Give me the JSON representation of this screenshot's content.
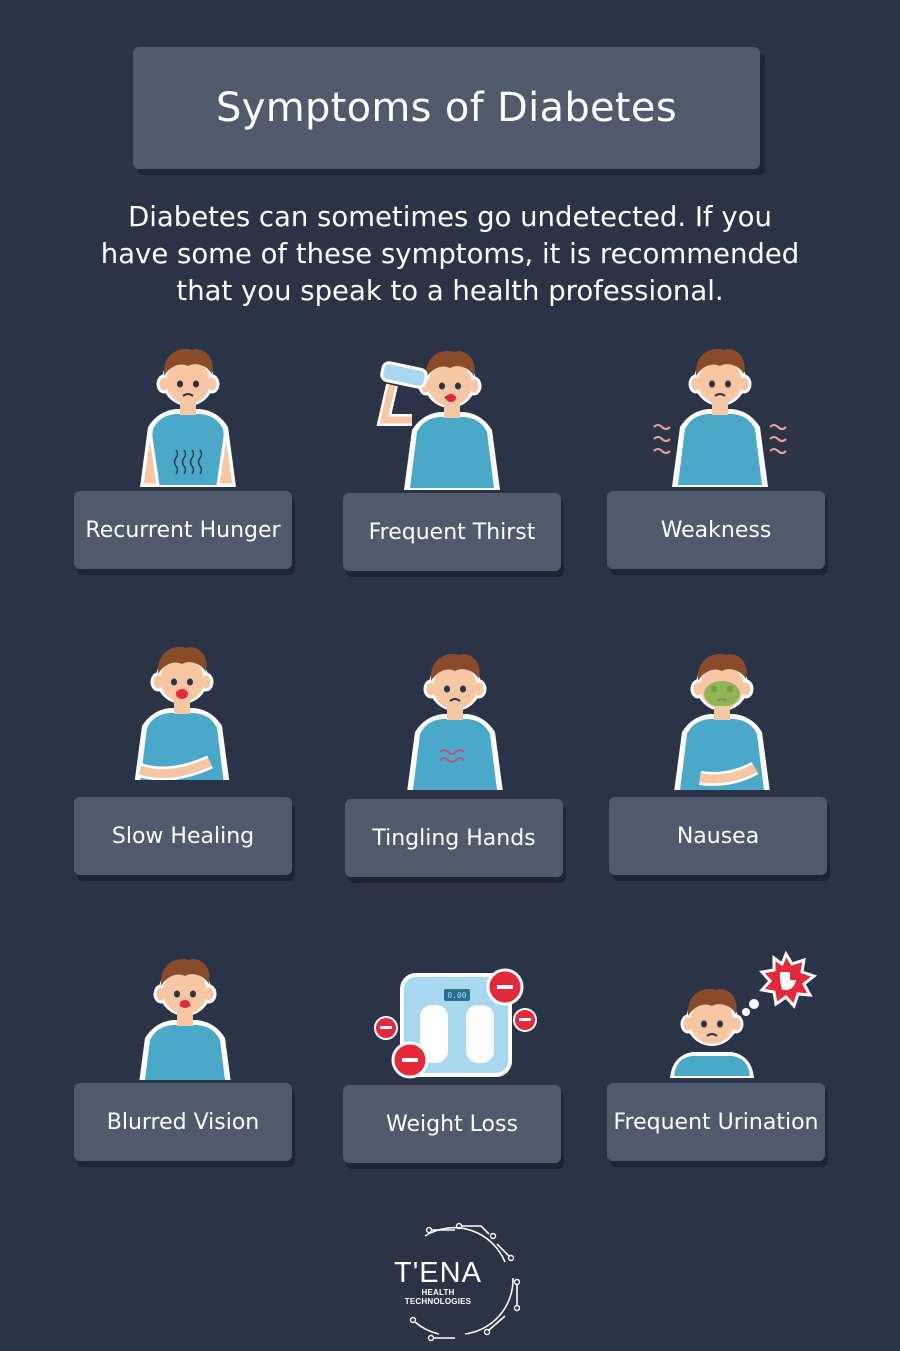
{
  "title": "Symptoms of Diabetes",
  "intro": "Diabetes can sometimes go undetected. If you have some of these symptoms, it is recommended that you speak to a health professional.",
  "symptoms": [
    {
      "label": "Recurrent Hunger",
      "icon": "hungry-person-icon"
    },
    {
      "label": "Frequent Thirst",
      "icon": "drinking-person-icon"
    },
    {
      "label": "Weakness",
      "icon": "weak-shivering-person-icon"
    },
    {
      "label": "Slow Healing",
      "icon": "pained-person-icon"
    },
    {
      "label": "Tingling Hands",
      "icon": "tingling-chest-person-icon"
    },
    {
      "label": "Nausea",
      "icon": "nauseous-person-icon"
    },
    {
      "label": "Blurred Vision",
      "icon": "crying-person-icon"
    },
    {
      "label": "Weight Loss",
      "icon": "weight-scale-icon"
    },
    {
      "label": "Frequent Urination",
      "icon": "toilet-thought-person-icon"
    }
  ],
  "scale_display": "0.00",
  "logo": {
    "name": "T'ENA",
    "tagline": "HEALTH TECHNOLOGIES"
  },
  "colors": {
    "background": "#2b3446",
    "panel": "#4f5b6c",
    "shirt": "#4aa8c8",
    "skin": "#f7c6a3",
    "hair": "#8a4b2a",
    "red": "#e5283a"
  }
}
